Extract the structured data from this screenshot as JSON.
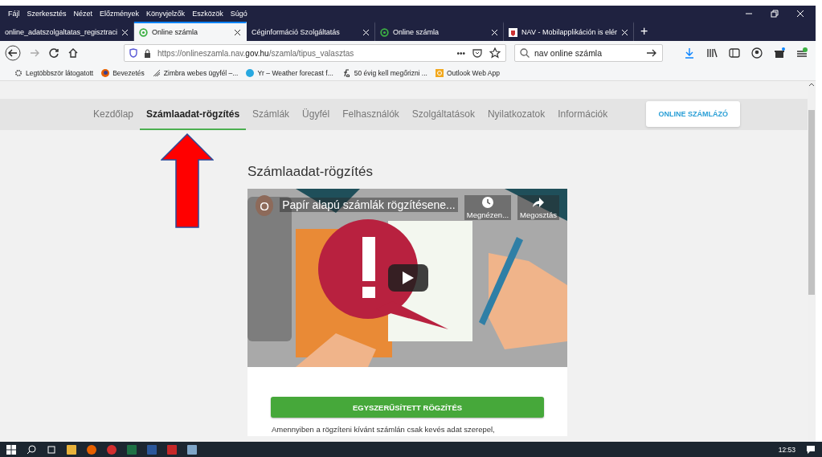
{
  "menu": [
    "Fájl",
    "Szerkesztés",
    "Nézet",
    "Előzmények",
    "Könyvjelzők",
    "Eszközök",
    "Súgó"
  ],
  "tabs": [
    {
      "label": "online_adatszolgaltatas_regisztraci",
      "selected": false,
      "kind": "plain"
    },
    {
      "label": "Online számla",
      "selected": true,
      "kind": "ring"
    },
    {
      "label": "Céginformáció Szolgáltatás",
      "selected": false,
      "kind": "plain"
    },
    {
      "label": "Online számla",
      "selected": false,
      "kind": "ring"
    },
    {
      "label": "NAV - Mobilapplikáción is elér",
      "selected": false,
      "kind": "site"
    }
  ],
  "new_tab": "+",
  "address": "https://onlineszamla.nav.**gov.hu**/szamla/tipus_valasztas",
  "page_actions": "•••",
  "search": "nav online számla",
  "bookmarks": [
    {
      "label": "Legtöbbször látogatott"
    },
    {
      "label": "Bevezetés"
    },
    {
      "label": "Zimbra webes ügyfél –..."
    },
    {
      "label": "Yr – Weather forecast f..."
    },
    {
      "label": "50 évig kell megőrizni ..."
    },
    {
      "label": "Outlook Web App"
    }
  ],
  "site_nav": [
    {
      "label": "Kezdőlap",
      "selected": false
    },
    {
      "label": "Számlaadat-rögzítés",
      "selected": true
    },
    {
      "label": "Számlák",
      "selected": false
    },
    {
      "label": "Ügyfél",
      "selected": false
    },
    {
      "label": "Felhasználók",
      "selected": false
    },
    {
      "label": "Szolgáltatások",
      "selected": false
    },
    {
      "label": "Nyilatkozatok",
      "selected": false
    },
    {
      "label": "Információk",
      "selected": false
    }
  ],
  "site_button": "ONLINE SZÁMLÁZÓ",
  "heading": "Számlaadat-rögzítés",
  "video": {
    "channel_initial": "O",
    "title": "Papír alapú számlák rögzítésene...",
    "watch_later": "Megnézen...",
    "share": "Megosztás"
  },
  "primary_button": "EGYSZERŰSÍTETT RÖGZÍTÉS",
  "description": "Amennyiben a rögzíteni kívánt számlán csak kevés adat szerepel,",
  "clock": "12:53"
}
